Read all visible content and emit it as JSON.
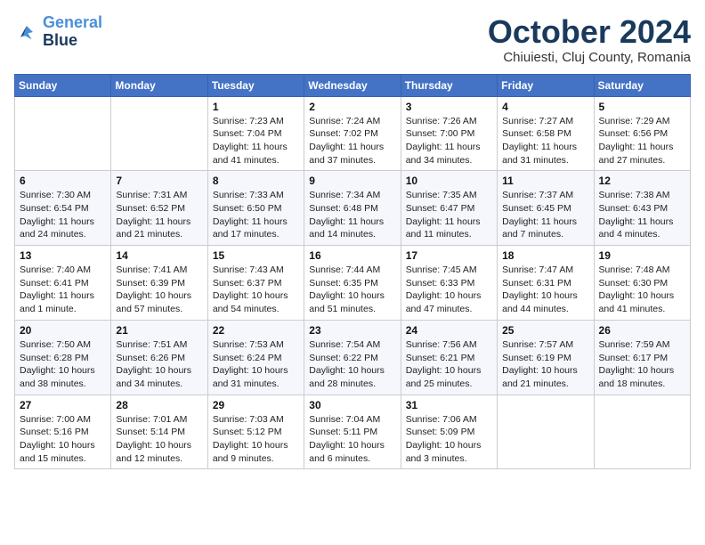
{
  "header": {
    "logo_line1": "General",
    "logo_line2": "Blue",
    "month_title": "October 2024",
    "subtitle": "Chiuiesti, Cluj County, Romania"
  },
  "weekdays": [
    "Sunday",
    "Monday",
    "Tuesday",
    "Wednesday",
    "Thursday",
    "Friday",
    "Saturday"
  ],
  "weeks": [
    [
      {
        "day": "",
        "info": ""
      },
      {
        "day": "",
        "info": ""
      },
      {
        "day": "1",
        "info": "Sunrise: 7:23 AM\nSunset: 7:04 PM\nDaylight: 11 hours and 41 minutes."
      },
      {
        "day": "2",
        "info": "Sunrise: 7:24 AM\nSunset: 7:02 PM\nDaylight: 11 hours and 37 minutes."
      },
      {
        "day": "3",
        "info": "Sunrise: 7:26 AM\nSunset: 7:00 PM\nDaylight: 11 hours and 34 minutes."
      },
      {
        "day": "4",
        "info": "Sunrise: 7:27 AM\nSunset: 6:58 PM\nDaylight: 11 hours and 31 minutes."
      },
      {
        "day": "5",
        "info": "Sunrise: 7:29 AM\nSunset: 6:56 PM\nDaylight: 11 hours and 27 minutes."
      }
    ],
    [
      {
        "day": "6",
        "info": "Sunrise: 7:30 AM\nSunset: 6:54 PM\nDaylight: 11 hours and 24 minutes."
      },
      {
        "day": "7",
        "info": "Sunrise: 7:31 AM\nSunset: 6:52 PM\nDaylight: 11 hours and 21 minutes."
      },
      {
        "day": "8",
        "info": "Sunrise: 7:33 AM\nSunset: 6:50 PM\nDaylight: 11 hours and 17 minutes."
      },
      {
        "day": "9",
        "info": "Sunrise: 7:34 AM\nSunset: 6:48 PM\nDaylight: 11 hours and 14 minutes."
      },
      {
        "day": "10",
        "info": "Sunrise: 7:35 AM\nSunset: 6:47 PM\nDaylight: 11 hours and 11 minutes."
      },
      {
        "day": "11",
        "info": "Sunrise: 7:37 AM\nSunset: 6:45 PM\nDaylight: 11 hours and 7 minutes."
      },
      {
        "day": "12",
        "info": "Sunrise: 7:38 AM\nSunset: 6:43 PM\nDaylight: 11 hours and 4 minutes."
      }
    ],
    [
      {
        "day": "13",
        "info": "Sunrise: 7:40 AM\nSunset: 6:41 PM\nDaylight: 11 hours and 1 minute."
      },
      {
        "day": "14",
        "info": "Sunrise: 7:41 AM\nSunset: 6:39 PM\nDaylight: 10 hours and 57 minutes."
      },
      {
        "day": "15",
        "info": "Sunrise: 7:43 AM\nSunset: 6:37 PM\nDaylight: 10 hours and 54 minutes."
      },
      {
        "day": "16",
        "info": "Sunrise: 7:44 AM\nSunset: 6:35 PM\nDaylight: 10 hours and 51 minutes."
      },
      {
        "day": "17",
        "info": "Sunrise: 7:45 AM\nSunset: 6:33 PM\nDaylight: 10 hours and 47 minutes."
      },
      {
        "day": "18",
        "info": "Sunrise: 7:47 AM\nSunset: 6:31 PM\nDaylight: 10 hours and 44 minutes."
      },
      {
        "day": "19",
        "info": "Sunrise: 7:48 AM\nSunset: 6:30 PM\nDaylight: 10 hours and 41 minutes."
      }
    ],
    [
      {
        "day": "20",
        "info": "Sunrise: 7:50 AM\nSunset: 6:28 PM\nDaylight: 10 hours and 38 minutes."
      },
      {
        "day": "21",
        "info": "Sunrise: 7:51 AM\nSunset: 6:26 PM\nDaylight: 10 hours and 34 minutes."
      },
      {
        "day": "22",
        "info": "Sunrise: 7:53 AM\nSunset: 6:24 PM\nDaylight: 10 hours and 31 minutes."
      },
      {
        "day": "23",
        "info": "Sunrise: 7:54 AM\nSunset: 6:22 PM\nDaylight: 10 hours and 28 minutes."
      },
      {
        "day": "24",
        "info": "Sunrise: 7:56 AM\nSunset: 6:21 PM\nDaylight: 10 hours and 25 minutes."
      },
      {
        "day": "25",
        "info": "Sunrise: 7:57 AM\nSunset: 6:19 PM\nDaylight: 10 hours and 21 minutes."
      },
      {
        "day": "26",
        "info": "Sunrise: 7:59 AM\nSunset: 6:17 PM\nDaylight: 10 hours and 18 minutes."
      }
    ],
    [
      {
        "day": "27",
        "info": "Sunrise: 7:00 AM\nSunset: 5:16 PM\nDaylight: 10 hours and 15 minutes."
      },
      {
        "day": "28",
        "info": "Sunrise: 7:01 AM\nSunset: 5:14 PM\nDaylight: 10 hours and 12 minutes."
      },
      {
        "day": "29",
        "info": "Sunrise: 7:03 AM\nSunset: 5:12 PM\nDaylight: 10 hours and 9 minutes."
      },
      {
        "day": "30",
        "info": "Sunrise: 7:04 AM\nSunset: 5:11 PM\nDaylight: 10 hours and 6 minutes."
      },
      {
        "day": "31",
        "info": "Sunrise: 7:06 AM\nSunset: 5:09 PM\nDaylight: 10 hours and 3 minutes."
      },
      {
        "day": "",
        "info": ""
      },
      {
        "day": "",
        "info": ""
      }
    ]
  ]
}
